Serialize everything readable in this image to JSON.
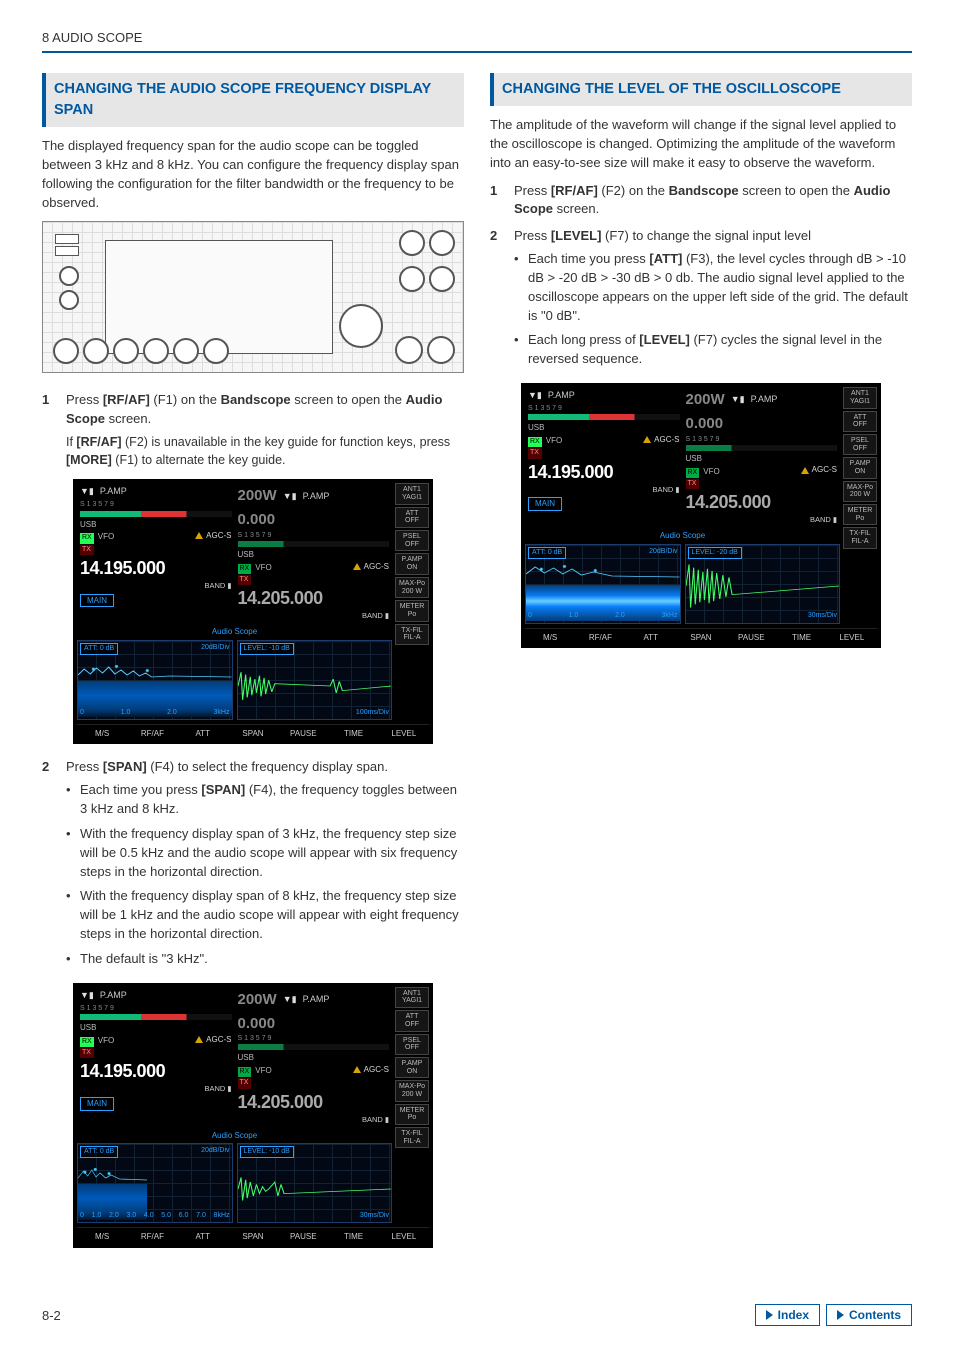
{
  "chapter_header": "8 AUDIO SCOPE",
  "left": {
    "heading": "CHANGING THE AUDIO SCOPE FREQUENCY DISPLAY SPAN",
    "intro": "The displayed frequency span for the audio scope can be toggled between 3 kHz and 8 kHz. You can configure the frequency display span following the configuration for the filter bandwidth or the frequency to be observed.",
    "step1_a": "Press ",
    "step1_b": "[RF/AF]",
    "step1_c": " (F1) on the ",
    "step1_d": "Bandscope",
    "step1_e": " screen to open the ",
    "step1_f": "Audio Scope",
    "step1_g": " screen.",
    "step1_note_a": "If ",
    "step1_note_b": "[RF/AF]",
    "step1_note_c": " (F2) is unavailable in the key guide for function keys, press ",
    "step1_note_d": "[MORE]",
    "step1_note_e": " (F1) to alternate the key guide.",
    "step2_a": "Press ",
    "step2_b": "[SPAN]",
    "step2_c": " (F4) to select the frequency display span.",
    "bul2_1a": "Each time you press ",
    "bul2_1b": "[SPAN]",
    "bul2_1c": " (F4), the frequency toggles between 3 kHz and 8 kHz.",
    "bul2_2": "With the frequency display span of 3 kHz, the frequency step size will be 0.5 kHz and the audio scope will appear with six frequency steps in the horizontal direction.",
    "bul2_3": "With the frequency display span of 8 kHz, the frequency step size will be 1 kHz and the audio scope will appear with eight frequency steps in the horizontal direction.",
    "bul2_4": "The default is \"3 kHz\"."
  },
  "right": {
    "heading": "CHANGING THE LEVEL OF THE OSCILLOSCOPE",
    "intro": "The amplitude of the waveform will change if the signal level applied to the oscilloscope is changed. Optimizing the amplitude of the waveform into an easy-to-see size will make it easy to observe the waveform.",
    "step1_a": "Press ",
    "step1_b": "[RF/AF]",
    "step1_c": " (F2) on the ",
    "step1_d": "Bandscope",
    "step1_e": " screen to open the ",
    "step1_f": "Audio Scope",
    "step1_g": " screen.",
    "step2_a": "Press ",
    "step2_b": "[LEVEL]",
    "step2_c": " (F7) to change the signal input level",
    "bul2_1a": "Each time you press ",
    "bul2_1b": "[ATT]",
    "bul2_1c": " (F3), the level cycles through dB > -10 dB > -20 dB > -30 dB > 0 db. The audio signal level applied to the oscilloscope appears on the upper left side of the grid. The default is \"0 dB\".",
    "bul2_2a": "Each long press of ",
    "bul2_2b": "[LEVEL]",
    "bul2_2c": " (F7) cycles the signal level in the reversed sequence."
  },
  "scope_common": {
    "pamp": "P.AMP",
    "usb": "USB",
    "agc": "AGC-S",
    "vfo": "VFO",
    "rx": "RX",
    "tx": "TX",
    "band": "BAND",
    "main": "MAIN",
    "title": "Audio Scope",
    "pwr200": "200W",
    "freq_main": "14.195.000",
    "freq_sub": "14.205.000",
    "pwr0": "0.000"
  },
  "scope1": {
    "att": "ATT: 0 dB",
    "dbdiv": "20dB/Div",
    "level": "LEVEL: -10 dB",
    "timediv": "100ms/Div",
    "xticks": [
      "0",
      "1.0",
      "2.0",
      "3kHz"
    ]
  },
  "scope2": {
    "att": "ATT: 0 dB",
    "dbdiv": "20dB/Div",
    "level": "LEVEL: -10 dB",
    "timediv": "30ms/Div",
    "xticks": [
      "0",
      "1.0",
      "2.0",
      "3.0",
      "4.0",
      "5.0",
      "6.0",
      "7.0",
      "8kHz"
    ]
  },
  "scope3": {
    "att": "ATT: 0 dB",
    "dbdiv": "20dB/Div",
    "level": "LEVEL: -20 dB",
    "timediv": "30ms/Div",
    "xticks": [
      "0",
      "1.0",
      "2.0",
      "3kHz"
    ]
  },
  "side_buttons": {
    "ant": "ANT1\nYAGI1",
    "att": "ATT\nOFF",
    "psel": "PSEL\nOFF",
    "pamp": "P.AMP\nON",
    "maxpo": "MAX-Po\n200 W",
    "meter": "METER\nPo",
    "txfil": "TX-FIL\nFIL-A"
  },
  "fkeys": {
    "f1": "M/S",
    "f2": "RF/AF",
    "f3": "ATT",
    "f4": "SPAN",
    "f5": "PAUSE",
    "f6": "TIME",
    "f7": "LEVEL"
  },
  "footer": {
    "page": "8-2",
    "index": "Index",
    "contents": "Contents"
  }
}
